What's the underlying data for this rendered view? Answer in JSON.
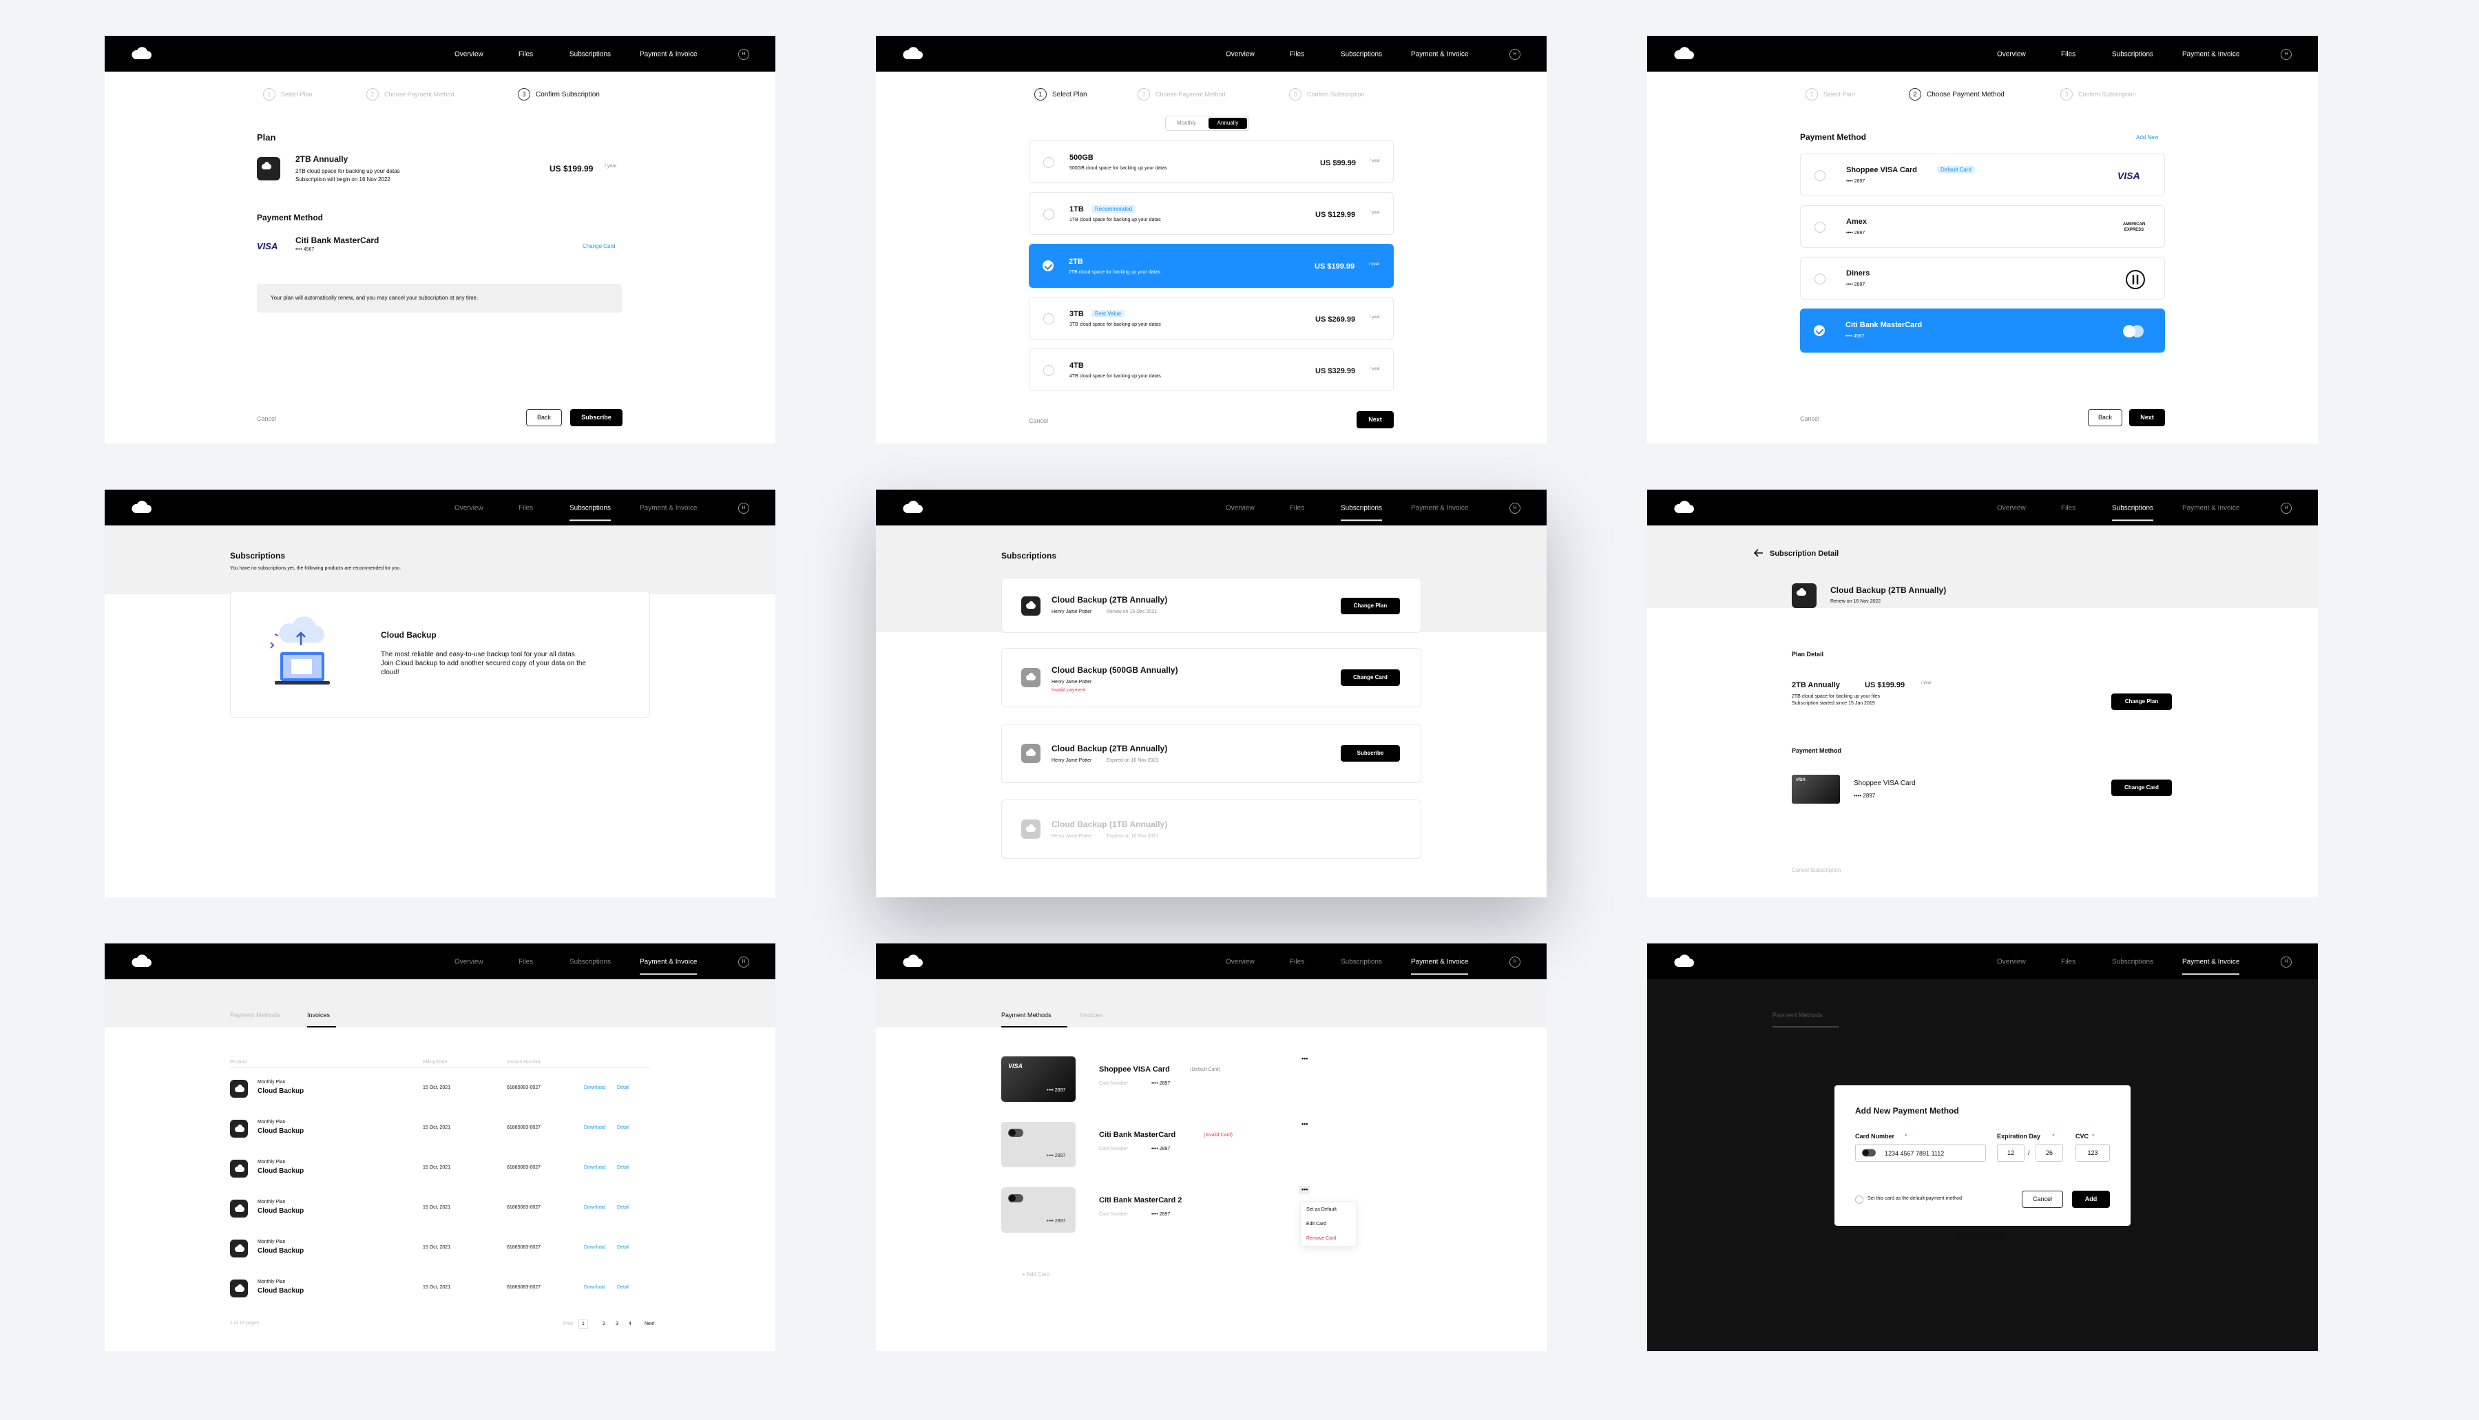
{
  "nav": {
    "overview": "Overview",
    "files": "Files",
    "subscriptions": "Subscriptions",
    "payment": "Payment & Invoice",
    "avatar": "H"
  },
  "common": {
    "cancel": "Cancel",
    "back": "Back",
    "next": "Next",
    "subscribe": "Subscribe",
    "per_year": "/ year"
  },
  "steps": {
    "s1": "Select Plan",
    "s2": "Choose Payment Method",
    "s3": "Confirm Subscription",
    "n1": "1",
    "n2": "2",
    "n3": "3"
  },
  "confirm": {
    "plan_heading": "Plan",
    "plan_name": "2TB Annually",
    "plan_desc": "2TB cloud space for backing up your datas",
    "plan_begin": "Subscription will begin on 16 Nov 2022",
    "plan_price": "US $199.99",
    "pm_heading": "Payment Method",
    "card_brand": "VISA",
    "card_name": "Citi Bank MasterCard",
    "card_num": "•••• 4567",
    "change_card": "Change Card",
    "notice": "Your plan will automatically renew, and you may cancel your subscription at any time."
  },
  "select_plan": {
    "monthly": "Monthly",
    "annually": "Annually",
    "plans": [
      {
        "name": "500GB",
        "desc": "500GB cloud space for backing up your datas",
        "price": "US $99.99",
        "badge": ""
      },
      {
        "name": "1TB",
        "desc": "1TB cloud space for backing up your datas",
        "price": "US $129.99",
        "badge": "Recommended"
      },
      {
        "name": "2TB",
        "desc": "2TB cloud space for backing up your datas",
        "price": "US $199.99",
        "badge": ""
      },
      {
        "name": "3TB",
        "desc": "3TB cloud space for backing up your datas",
        "price": "US $269.99",
        "badge": "Best Value"
      },
      {
        "name": "4TB",
        "desc": "4TB cloud space for backing up your datas",
        "price": "US $329.99",
        "badge": ""
      }
    ]
  },
  "choose_pm": {
    "heading": "Payment Method",
    "add_new": "Add New",
    "default_badge": "Default Card",
    "cards": [
      {
        "name": "Shoppee VISA Card",
        "num": "•••• 2897",
        "logo": "VISA"
      },
      {
        "name": "Amex",
        "num": "•••• 2897",
        "logo": "AMERICAN EXPRESS"
      },
      {
        "name": "Diners",
        "num": "•••• 2897",
        "logo": "diners-logo"
      },
      {
        "name": "Citi Bank MasterCard",
        "num": "•••• 4567",
        "logo": "mastercard-logo"
      }
    ]
  },
  "subs_empty": {
    "title": "Subscriptions",
    "subtitle": "You have no subscriptions yet, the following products are recommended for you.",
    "product": "Cloud Backup",
    "desc": "The most reliable and easy-to-use backup tool for your all datas. Join Cloud backup to add another secured copy of your data on the cloud!"
  },
  "subs_list": {
    "title": "Subscriptions",
    "items": [
      {
        "name": "Cloud Backup (2TB Annually)",
        "user": "Henry Jame Potter",
        "status": "Renew on 16 Dec 2021",
        "action": "Change Plan",
        "warn": ""
      },
      {
        "name": "Cloud Backup (500GB Annually)",
        "user": "Henry Jame Potter",
        "status": "",
        "action": "Change Card",
        "warn": "Invalid payment"
      },
      {
        "name": "Cloud Backup (2TB Annually)",
        "user": "Henry Jame Potter",
        "status": "Expired on 16 Nov 2021",
        "action": "Subscribe",
        "warn": ""
      },
      {
        "name": "Cloud Backup (1TB Annually)",
        "user": "Henry Jame Potter",
        "status": "Expired on 16 Nov 2021",
        "action": "",
        "warn": ""
      }
    ]
  },
  "sub_detail": {
    "title": "Subscription Detail",
    "product": "Cloud Backup  (2TB Annually)",
    "renew": "Renew on 16 Nov 2022",
    "plan_detail": "Plan Detail",
    "plan_name": "2TB Annually",
    "plan_price": "US $199.99",
    "plan_desc": "2TB cloud space for backing up your files",
    "since": "Subscription started since 15 Jan 2019",
    "change_plan": "Change Plan",
    "pm_heading": "Payment Method",
    "card_name": "Shoppee VISA Card",
    "card_num": "•••• 2897",
    "card_brand": "VISA",
    "change_card": "Change Card",
    "cancel_sub": "Cancel Subscription"
  },
  "invoices": {
    "tab_pm": "Payment Methods",
    "tab_inv": "Invoices",
    "col_product": "Product",
    "col_date": "Billing Date",
    "col_num": "Invoice Number",
    "download": "Download",
    "detail": "Detail",
    "rows": [
      {
        "plan": "Monthly Plan",
        "product": "Cloud Backup",
        "date": "15 Oct, 2021",
        "num": "61865083-0027"
      },
      {
        "plan": "Monthly Plan",
        "product": "Cloud Backup",
        "date": "15 Oct, 2021",
        "num": "61865083-0027"
      },
      {
        "plan": "Monthly Plan",
        "product": "Cloud Backup",
        "date": "15 Oct, 2021",
        "num": "61865083-0027"
      },
      {
        "plan": "Monthly Plan",
        "product": "Cloud Backup",
        "date": "15 Oct, 2021",
        "num": "61865083-0027"
      },
      {
        "plan": "Monthly Plan",
        "product": "Cloud Backup",
        "date": "15 Oct, 2021",
        "num": "61865083-0027"
      },
      {
        "plan": "Monthly Plan",
        "product": "Cloud Backup",
        "date": "15 Oct, 2021",
        "num": "61865083-0027"
      }
    ],
    "range": "1 of 10 pages",
    "prev": "Prev",
    "pages": [
      "1",
      "2",
      "3",
      "4"
    ],
    "next_page": "Next"
  },
  "pm_list": {
    "tab_pm": "Payment Methods",
    "tab_inv": "Invoices",
    "card_number_label": "Card Number",
    "cards": [
      {
        "name": "Shoppee VISA Card",
        "tag": "(Default Card)",
        "num": "•••• 2897",
        "face_num": "•••• 2897",
        "brand": "VISA"
      },
      {
        "name": "Citi Bank MasterCard",
        "tag": "(Invalid Card)",
        "num": "•••• 2897",
        "face_num": "•••• 2897",
        "brand": ""
      },
      {
        "name": "Citi Bank MasterCard 2",
        "tag": "",
        "num": "•••• 2897",
        "face_num": "•••• 2897",
        "brand": ""
      }
    ],
    "menu": {
      "set_default": "Set as Default",
      "edit": "Edit Card",
      "remove": "Remove Card"
    },
    "add_card": "+ Add Card",
    "more": "•••"
  },
  "add_pm": {
    "title": "Add New Payment Method",
    "card_number_label": "Card Number",
    "card_number": "1234  4567  7891  1112",
    "exp_label": "Expiration Day",
    "exp_month": "12",
    "exp_sep": "/",
    "exp_year": "26",
    "cvc_label": "CVC",
    "cvc": "123",
    "req": "*",
    "default_check": "Set this card as the default payment method",
    "cancel": "Cancel",
    "add": "Add"
  },
  "colors": {
    "accent": "#1b8fff",
    "link": "#1b9de0",
    "danger": "#e5343f",
    "dark": "#000000"
  }
}
